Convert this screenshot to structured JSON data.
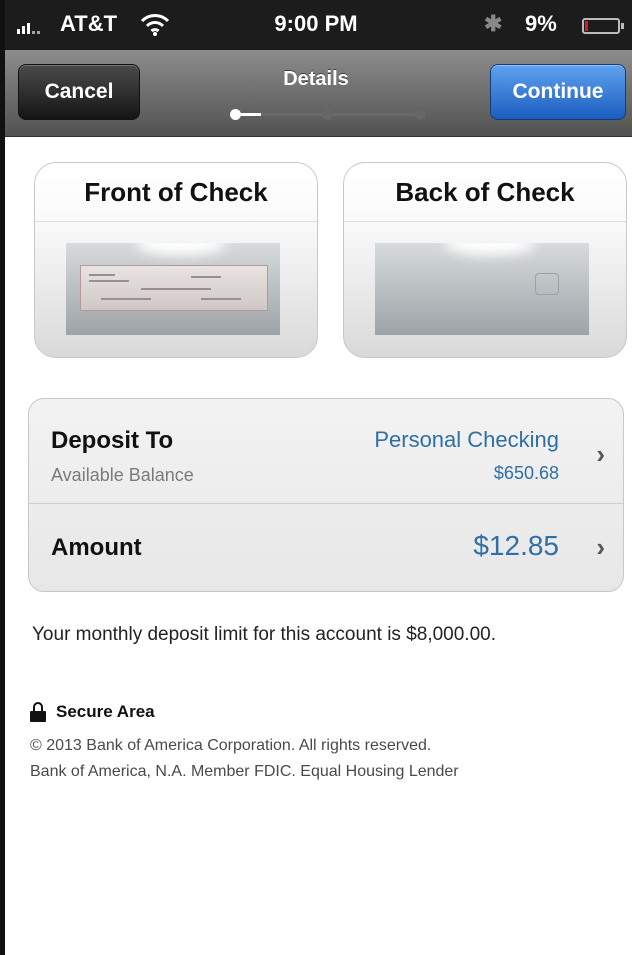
{
  "status_bar": {
    "carrier": "AT&T",
    "time": "9:00 PM",
    "battery_percent": "9%",
    "battery_level": 0.09,
    "battery_color": "#e0142b"
  },
  "nav": {
    "cancel_label": "Cancel",
    "title": "Details",
    "continue_label": "Continue",
    "progress_step": 1,
    "progress_total": 3,
    "continue_color": "#1b5dc0"
  },
  "front_card": {
    "title": "Front of Check",
    "icon": "check-front-image"
  },
  "back_card": {
    "title": "Back of Check",
    "icon": "check-back-image"
  },
  "deposit_row": {
    "label": "Deposit To",
    "sublabel": "Available Balance",
    "account": "Personal Checking",
    "balance": "$650.68",
    "icon": "chevron-right-icon"
  },
  "amount_row": {
    "label": "Amount",
    "value": "$12.85",
    "icon": "chevron-right-icon"
  },
  "accent_color": "#2f6fa6",
  "limit_text": "Your monthly deposit limit for this account is $8,000.00.",
  "secure": {
    "label": "Secure Area",
    "icon": "lock-icon"
  },
  "legal": {
    "line1": "© 2013  Bank of America Corporation. All rights reserved.",
    "line2": "Bank of America, N.A. Member FDIC. Equal Housing Lender"
  }
}
